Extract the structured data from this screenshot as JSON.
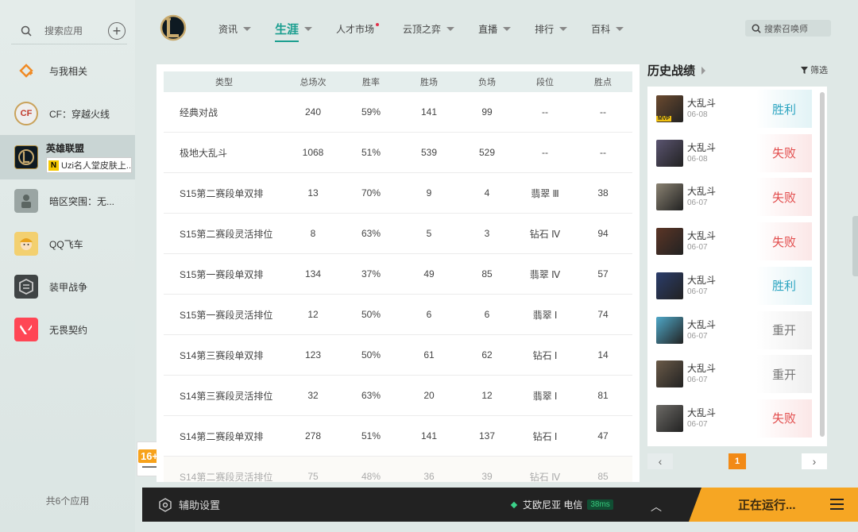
{
  "sidebar": {
    "search_placeholder": "搜索应用",
    "apps": [
      {
        "label": "与我相关"
      },
      {
        "label": "CF：穿越火线"
      },
      {
        "label": "英雄联盟",
        "news": "Uzi名人堂皮肤上..."
      },
      {
        "label": "暗区突围：无..."
      },
      {
        "label": "QQ飞车"
      },
      {
        "label": "装甲战争"
      },
      {
        "label": "无畏契约"
      }
    ],
    "news_badge": "N",
    "app_count": "共6个应用",
    "age_rating": "16+"
  },
  "nav": {
    "items": [
      {
        "label": "资讯",
        "caret": true
      },
      {
        "label": "生涯",
        "caret": true,
        "active": true
      },
      {
        "label": "人才市场",
        "dot": true
      },
      {
        "label": "云顶之弈",
        "caret": true
      },
      {
        "label": "直播",
        "caret": true
      },
      {
        "label": "排行",
        "caret": true
      },
      {
        "label": "百科",
        "caret": true
      }
    ],
    "search_placeholder": "搜索召唤师"
  },
  "stats_table": {
    "headers": [
      "类型",
      "总场次",
      "胜率",
      "胜场",
      "负场",
      "段位",
      "胜点"
    ],
    "rows": [
      [
        "经典对战",
        "240",
        "59%",
        "141",
        "99",
        "--",
        "--"
      ],
      [
        "极地大乱斗",
        "1068",
        "51%",
        "539",
        "529",
        "--",
        "--"
      ],
      [
        "S15第二赛段单双排",
        "13",
        "70%",
        "9",
        "4",
        "翡翠 Ⅲ",
        "38"
      ],
      [
        "S15第二赛段灵活排位",
        "8",
        "63%",
        "5",
        "3",
        "钻石 Ⅳ",
        "94"
      ],
      [
        "S15第一赛段单双排",
        "134",
        "37%",
        "49",
        "85",
        "翡翠 Ⅳ",
        "57"
      ],
      [
        "S15第一赛段灵活排位",
        "12",
        "50%",
        "6",
        "6",
        "翡翠 Ⅰ",
        "74"
      ],
      [
        "S14第三赛段单双排",
        "123",
        "50%",
        "61",
        "62",
        "钻石 Ⅰ",
        "14"
      ],
      [
        "S14第三赛段灵活排位",
        "32",
        "63%",
        "20",
        "12",
        "翡翠 Ⅰ",
        "81"
      ],
      [
        "S14第二赛段单双排",
        "278",
        "51%",
        "141",
        "137",
        "钻石 Ⅰ",
        "47"
      ],
      [
        "S14第二赛段灵活排位",
        "75",
        "48%",
        "36",
        "39",
        "钻石 Ⅳ",
        "85"
      ]
    ]
  },
  "history": {
    "title": "历史战绩",
    "filter_label": "筛选",
    "mvp_label": "MVP",
    "matches": [
      {
        "mode": "大乱斗",
        "date": "06-08",
        "result": "胜利",
        "kind": "win",
        "mvp": true,
        "color": "#6b4a2f"
      },
      {
        "mode": "大乱斗",
        "date": "06-08",
        "result": "失败",
        "kind": "lose",
        "mvp": false,
        "color": "#5a5470"
      },
      {
        "mode": "大乱斗",
        "date": "06-07",
        "result": "失败",
        "kind": "lose",
        "mvp": false,
        "color": "#8a8272"
      },
      {
        "mode": "大乱斗",
        "date": "06-07",
        "result": "失败",
        "kind": "lose",
        "mvp": false,
        "color": "#5b3526"
      },
      {
        "mode": "大乱斗",
        "date": "06-07",
        "result": "胜利",
        "kind": "win",
        "mvp": false,
        "color": "#2b3d6b"
      },
      {
        "mode": "大乱斗",
        "date": "06-07",
        "result": "重开",
        "kind": "remake",
        "mvp": false,
        "color": "#4fa8c8"
      },
      {
        "mode": "大乱斗",
        "date": "06-07",
        "result": "重开",
        "kind": "remake",
        "mvp": false,
        "color": "#6a5a48"
      },
      {
        "mode": "大乱斗",
        "date": "06-07",
        "result": "失败",
        "kind": "lose",
        "mvp": false,
        "color": "#6c6a66"
      }
    ],
    "current_page": "1",
    "prev_glyph": "‹",
    "next_glyph": "›"
  },
  "bottom": {
    "assist_label": "辅助设置",
    "server": "艾欧尼亚 电信",
    "ping": "38ms",
    "up_glyph": "︿",
    "running_label": "正在运行..."
  },
  "colors": {
    "accent": "#1a9e8f",
    "win": "#2aa4c0",
    "lose": "#e24c4c",
    "running": "#f6a623"
  }
}
